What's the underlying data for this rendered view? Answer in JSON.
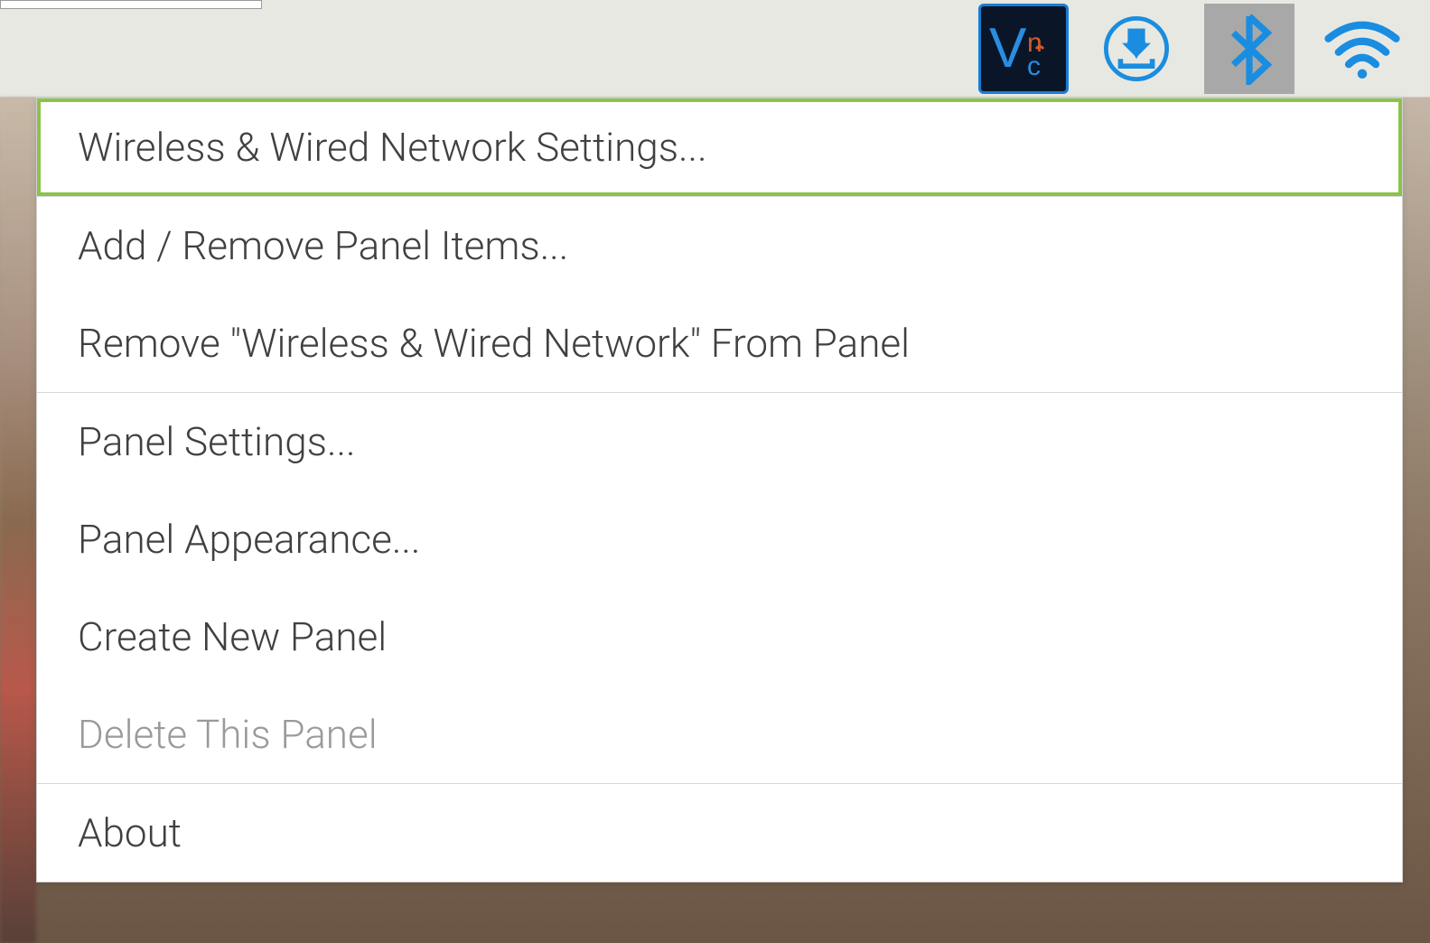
{
  "panel": {
    "icons": {
      "vnc": "vnc-icon",
      "download": "download-icon",
      "bluetooth": "bluetooth-icon",
      "wifi": "wifi-icon"
    }
  },
  "context_menu": {
    "items": [
      {
        "label": "Wireless & Wired Network Settings...",
        "highlighted": true,
        "disabled": false
      },
      {
        "label": "Add / Remove Panel Items...",
        "highlighted": false,
        "disabled": false
      },
      {
        "label": "Remove \"Wireless & Wired Network\" From Panel",
        "highlighted": false,
        "disabled": false
      },
      {
        "label": "Panel Settings...",
        "highlighted": false,
        "disabled": false
      },
      {
        "label": "Panel Appearance...",
        "highlighted": false,
        "disabled": false
      },
      {
        "label": "Create New Panel",
        "highlighted": false,
        "disabled": false
      },
      {
        "label": "Delete This Panel",
        "highlighted": false,
        "disabled": true
      },
      {
        "label": "About",
        "highlighted": false,
        "disabled": false
      }
    ]
  }
}
